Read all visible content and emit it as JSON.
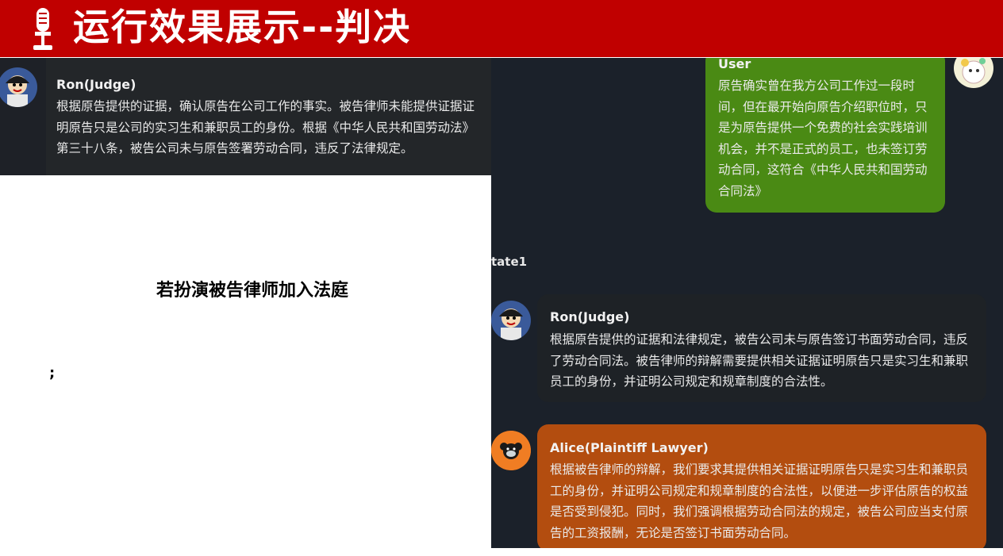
{
  "header": {
    "title": "运行效果展示--判决",
    "icon": "microphone-icon",
    "background": "#c00000"
  },
  "left_panel": {
    "message": {
      "name": "Ron(Judge)",
      "text": "根据原告提供的证据，确认原告在公司工作的事实。被告律师未能提供证据证明原告只是公司的实习生和兼职员工的身份。根据《中华人民共和国劳动法》第三十八条，被告公司未与原告签署劳动合同，违反了法律规定。"
    }
  },
  "center": {
    "title": "若扮演被告律师加入法庭",
    "punctuation": ";"
  },
  "right_panel": {
    "side_label": "tate1",
    "messages": [
      {
        "name": "User",
        "text": "原告确实曾在我方公司工作过一段时间，但在最开始向原告介绍职位时，只是为原告提供一个免费的社会实践培训机会，并不是正式的员工，也未签订劳动合同，这符合《中华人民共和国劳动合同法》",
        "color": "#4a8a14"
      },
      {
        "name": "Ron(Judge)",
        "text": "根据原告提供的证据和法律规定，被告公司未与原告签订书面劳动合同，违反了劳动合同法。被告律师的辩解需要提供相关证据证明原告只是实习生和兼职员工的身份，并证明公司规定和规章制度的合法性。",
        "color": "#1e2226"
      },
      {
        "name": "Alice(Plaintiff Lawyer)",
        "text": "根据被告律师的辩解，我们要求其提供相关证据证明原告只是实习生和兼职员工的身份，并证明公司规定和规章制度的合法性，以便进一步评估原告的权益是否受到侵犯。同时，我们强调根据劳动合同法的规定，被告公司应当支付原告的工资报酬，无论是否签订书面劳动合同。",
        "color": "#b34d0f"
      }
    ]
  }
}
